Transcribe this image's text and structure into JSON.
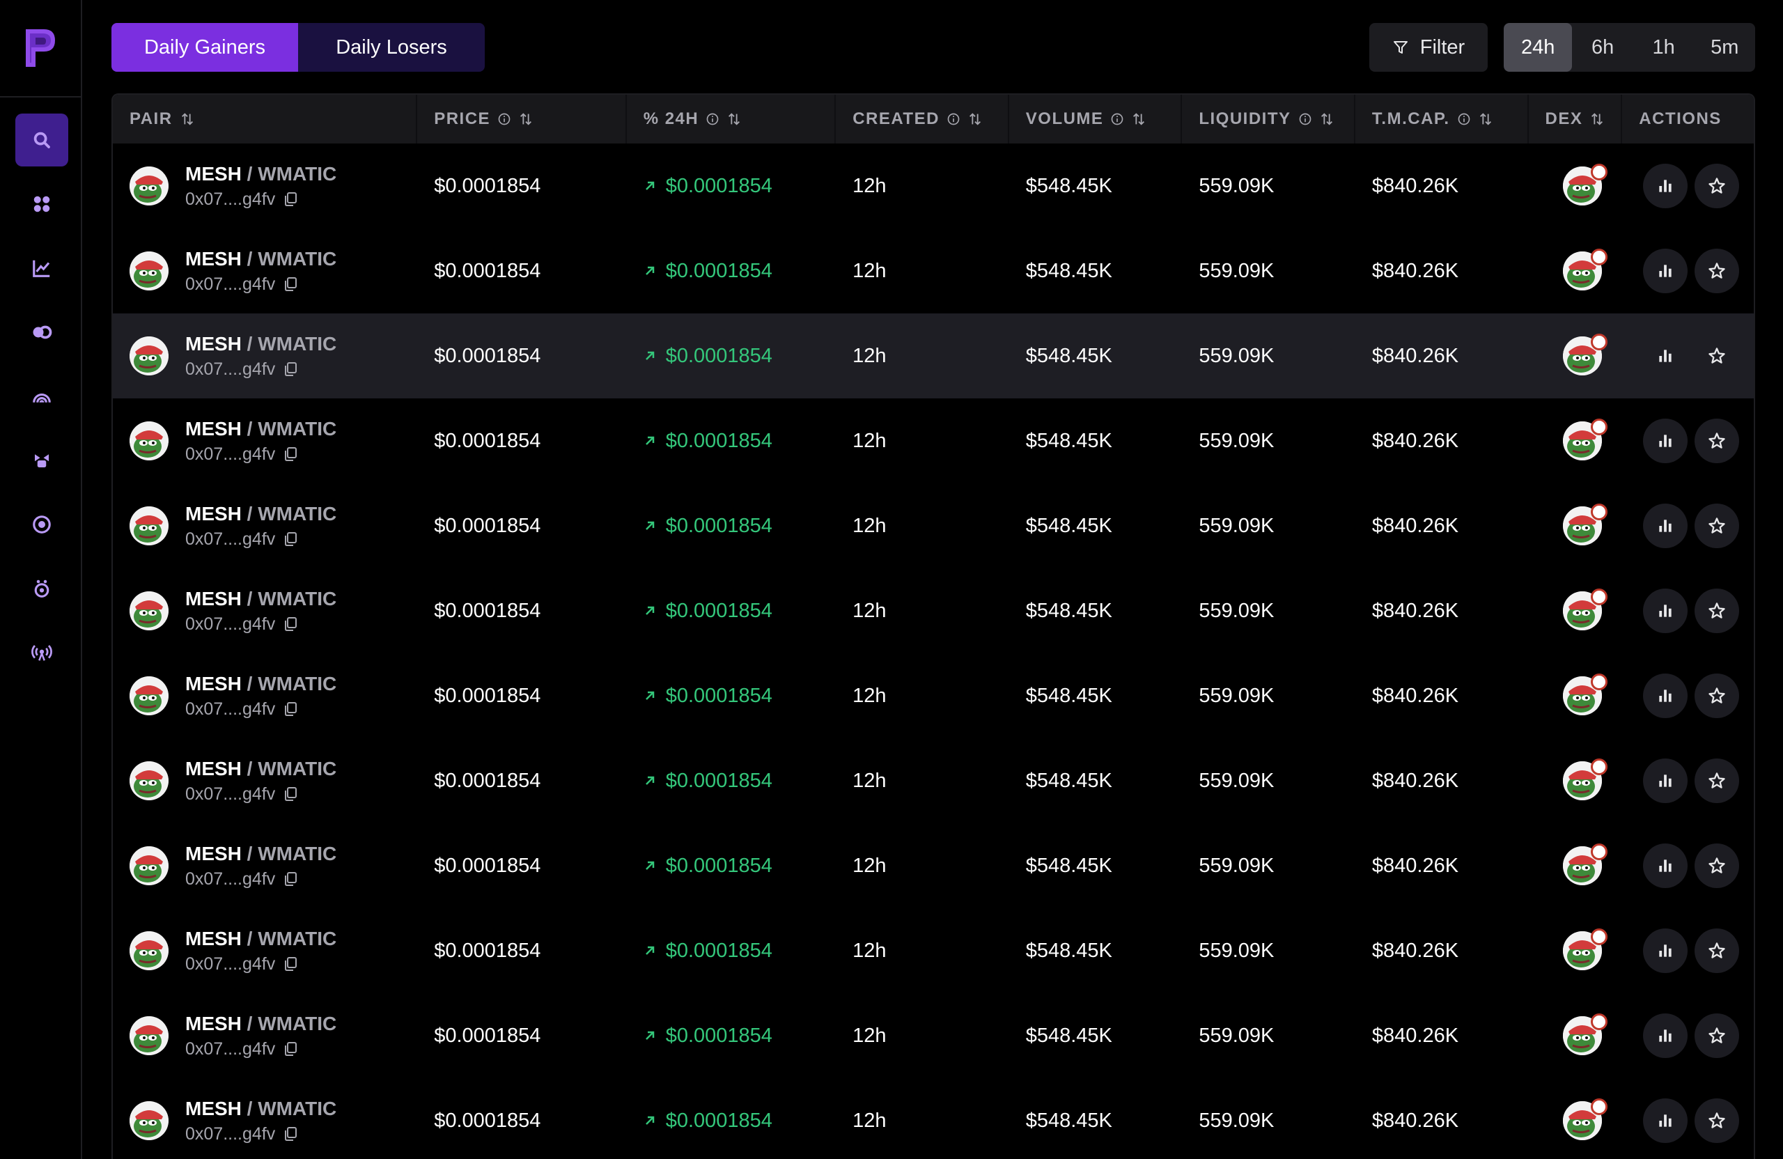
{
  "tabs": {
    "gainers": "Daily Gainers",
    "losers": "Daily Losers"
  },
  "filter_label": "Filter",
  "timeframes": [
    "24h",
    "6h",
    "1h",
    "5m"
  ],
  "columns": {
    "pair": "PAIR",
    "price": "PRICE",
    "change": "% 24H",
    "created": "CREATED",
    "volume": "VOLUME",
    "liquidity": "LIQUIDITY",
    "mcap": "T.M.CAP.",
    "dex": "DEX",
    "actions": "ACTIONS"
  },
  "sidebar": {
    "icons": [
      "search-icon",
      "apps-icon",
      "chart-line-icon",
      "toggle-icon",
      "rainbow-icon",
      "gift-icon",
      "target-icon",
      "timer-icon",
      "broadcast-icon"
    ]
  },
  "rows": [
    {
      "base": "MESH",
      "sep": " / ",
      "quote": "WMATIC",
      "address": "0x07....g4fv",
      "price": "$0.0001854",
      "change": "$0.0001854",
      "created": "12h",
      "volume": "$548.45K",
      "liquidity": "559.09K",
      "mcap": "$840.26K"
    },
    {
      "base": "MESH",
      "sep": " / ",
      "quote": "WMATIC",
      "address": "0x07....g4fv",
      "price": "$0.0001854",
      "change": "$0.0001854",
      "created": "12h",
      "volume": "$548.45K",
      "liquidity": "559.09K",
      "mcap": "$840.26K"
    },
    {
      "base": "MESH",
      "sep": " / ",
      "quote": "WMATIC",
      "address": "0x07....g4fv",
      "price": "$0.0001854",
      "change": "$0.0001854",
      "created": "12h",
      "volume": "$548.45K",
      "liquidity": "559.09K",
      "mcap": "$840.26K"
    },
    {
      "base": "MESH",
      "sep": " / ",
      "quote": "WMATIC",
      "address": "0x07....g4fv",
      "price": "$0.0001854",
      "change": "$0.0001854",
      "created": "12h",
      "volume": "$548.45K",
      "liquidity": "559.09K",
      "mcap": "$840.26K"
    },
    {
      "base": "MESH",
      "sep": " / ",
      "quote": "WMATIC",
      "address": "0x07....g4fv",
      "price": "$0.0001854",
      "change": "$0.0001854",
      "created": "12h",
      "volume": "$548.45K",
      "liquidity": "559.09K",
      "mcap": "$840.26K"
    },
    {
      "base": "MESH",
      "sep": " / ",
      "quote": "WMATIC",
      "address": "0x07....g4fv",
      "price": "$0.0001854",
      "change": "$0.0001854",
      "created": "12h",
      "volume": "$548.45K",
      "liquidity": "559.09K",
      "mcap": "$840.26K"
    },
    {
      "base": "MESH",
      "sep": " / ",
      "quote": "WMATIC",
      "address": "0x07....g4fv",
      "price": "$0.0001854",
      "change": "$0.0001854",
      "created": "12h",
      "volume": "$548.45K",
      "liquidity": "559.09K",
      "mcap": "$840.26K"
    },
    {
      "base": "MESH",
      "sep": " / ",
      "quote": "WMATIC",
      "address": "0x07....g4fv",
      "price": "$0.0001854",
      "change": "$0.0001854",
      "created": "12h",
      "volume": "$548.45K",
      "liquidity": "559.09K",
      "mcap": "$840.26K"
    },
    {
      "base": "MESH",
      "sep": " / ",
      "quote": "WMATIC",
      "address": "0x07....g4fv",
      "price": "$0.0001854",
      "change": "$0.0001854",
      "created": "12h",
      "volume": "$548.45K",
      "liquidity": "559.09K",
      "mcap": "$840.26K"
    },
    {
      "base": "MESH",
      "sep": " / ",
      "quote": "WMATIC",
      "address": "0x07....g4fv",
      "price": "$0.0001854",
      "change": "$0.0001854",
      "created": "12h",
      "volume": "$548.45K",
      "liquidity": "559.09K",
      "mcap": "$840.26K"
    },
    {
      "base": "MESH",
      "sep": " / ",
      "quote": "WMATIC",
      "address": "0x07....g4fv",
      "price": "$0.0001854",
      "change": "$0.0001854",
      "created": "12h",
      "volume": "$548.45K",
      "liquidity": "559.09K",
      "mcap": "$840.26K"
    },
    {
      "base": "MESH",
      "sep": " / ",
      "quote": "WMATIC",
      "address": "0x07....g4fv",
      "price": "$0.0001854",
      "change": "$0.0001854",
      "created": "12h",
      "volume": "$548.45K",
      "liquidity": "559.09K",
      "mcap": "$840.26K"
    }
  ],
  "highlighted_row": 2,
  "colors": {
    "accent": "#7b2fe0",
    "positive": "#34c77b",
    "muted": "#a6a6ae"
  }
}
